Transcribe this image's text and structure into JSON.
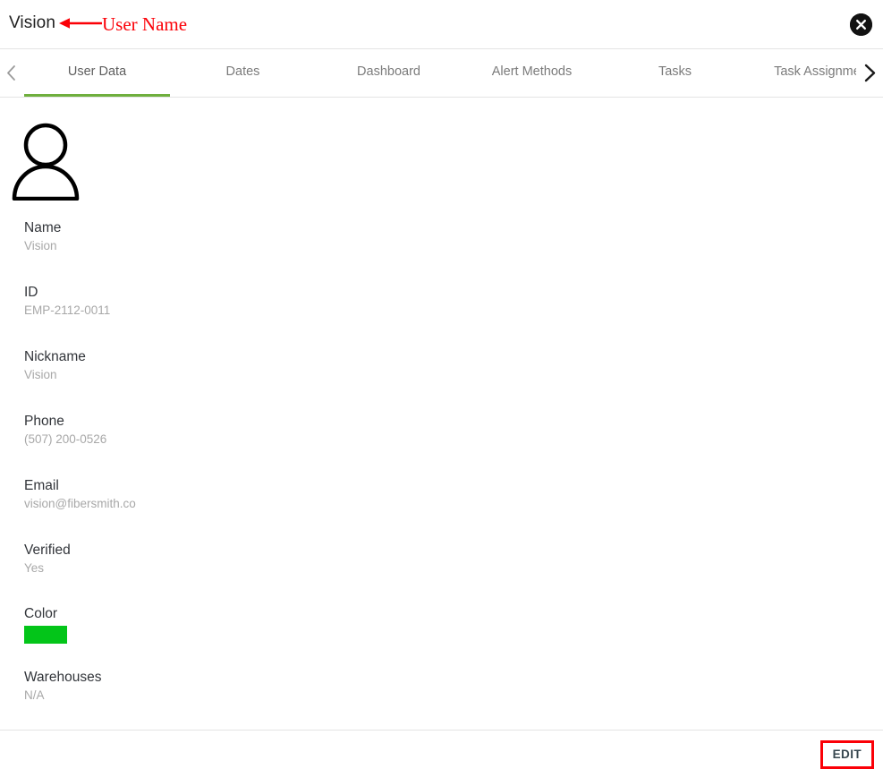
{
  "header": {
    "title": "Vision",
    "close_icon": "close-circle-icon"
  },
  "annotation": {
    "label": "User Name",
    "color": "#fb0007",
    "arrow_icon": "left-arrow-icon"
  },
  "tabs": {
    "prev_icon": "chevron-left-icon",
    "next_icon": "chevron-right-icon",
    "active_index": 0,
    "active_underline_color": "#6faf3d",
    "items": [
      {
        "label": "User Data"
      },
      {
        "label": "Dates"
      },
      {
        "label": "Dashboard"
      },
      {
        "label": "Alert Methods"
      },
      {
        "label": "Tasks"
      },
      {
        "label": "Task Assignmen"
      }
    ]
  },
  "user": {
    "avatar_icon": "person-avatar-icon",
    "fields": [
      {
        "label": "Name",
        "value": "Vision"
      },
      {
        "label": "ID",
        "value": "EMP-2112-0011"
      },
      {
        "label": "Nickname",
        "value": "Vision"
      },
      {
        "label": "Phone",
        "value": "(507) 200-0526"
      },
      {
        "label": "Email",
        "value": "vision@fibersmith.co"
      },
      {
        "label": "Verified",
        "value": "Yes"
      },
      {
        "label": "Color",
        "value": "",
        "swatch": "#03c519"
      },
      {
        "label": "Warehouses",
        "value": "N/A"
      }
    ]
  },
  "footer": {
    "edit_label": "EDIT"
  }
}
